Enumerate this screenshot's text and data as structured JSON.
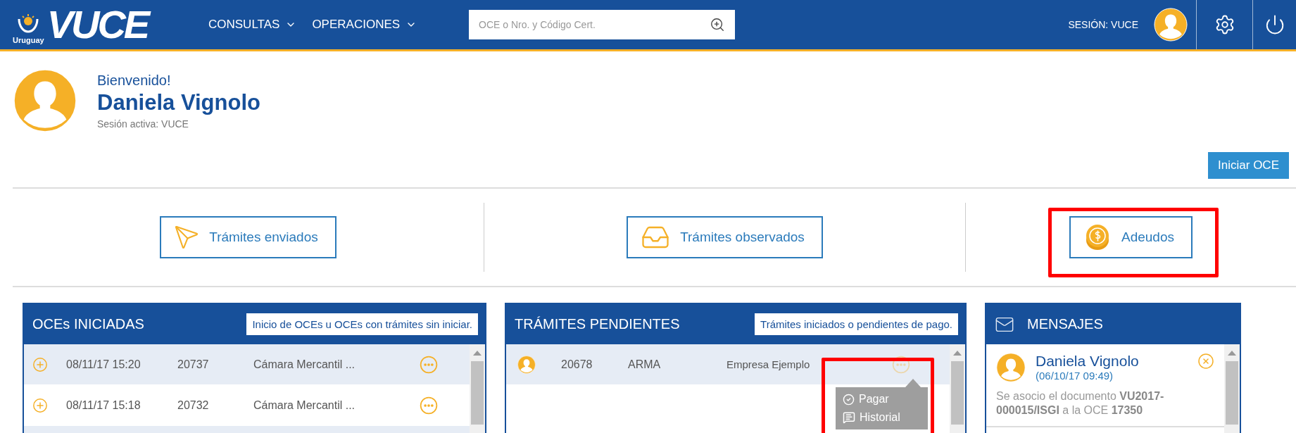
{
  "header": {
    "logo_caption": "Uruguay",
    "logo_text": "VUCE",
    "nav": [
      {
        "label": "CONSULTAS"
      },
      {
        "label": "OPERACIONES"
      }
    ],
    "search": {
      "placeholder": "OCE o Nro. y Código Cert."
    },
    "session": "SESIÓN: VUCE"
  },
  "welcome": {
    "greeting": "Bienvenido!",
    "name": "Daniela Vignolo",
    "session": "Sesión activa: VUCE"
  },
  "primary_button": "Iniciar OCE",
  "shortcuts": [
    {
      "kind": "sent",
      "label": "Trámites enviados",
      "highlighted": false
    },
    {
      "kind": "observed",
      "label": "Trámites observados",
      "highlighted": false
    },
    {
      "kind": "debts",
      "label": "Adeudos",
      "highlighted": true
    }
  ],
  "oces": {
    "title": "OCEs INICIADAS",
    "hint": "Inicio de OCEs u OCEs con trámites sin iniciar.",
    "rows": [
      {
        "date": "08/11/17 15:20",
        "number": "20737",
        "company": "Cámara Mercantil ..."
      },
      {
        "date": "08/11/17 15:18",
        "number": "20732",
        "company": "Cámara Mercantil ..."
      }
    ]
  },
  "pending": {
    "title": "TRÁMITES PENDIENTES",
    "hint": "Trámites iniciados o pendientes de pago.",
    "rows": [
      {
        "number": "20678",
        "type": "ARMA",
        "company": "Empresa Ejemplo",
        "menu_open": true
      }
    ],
    "menu": {
      "highlighted": true,
      "items": [
        {
          "kind": "pay",
          "label": "Pagar"
        },
        {
          "kind": "history",
          "label": "Historial"
        }
      ]
    }
  },
  "messages": {
    "title": "MENSAJES",
    "items": [
      {
        "sender": "Daniela Vignolo",
        "time": "(06/10/17 09:49)",
        "text": "Se asocio el documento **VU2017-000015/ISGI** a la OCE **17350**"
      }
    ]
  }
}
